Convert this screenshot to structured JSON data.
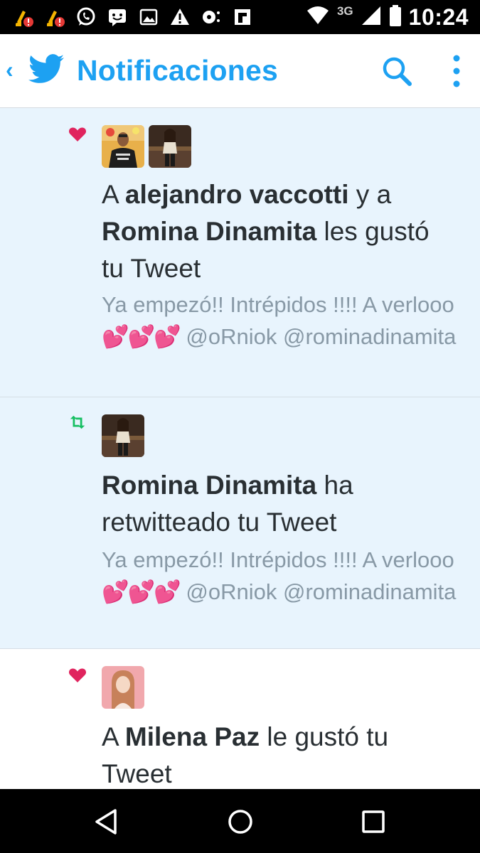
{
  "status_bar": {
    "time": "10:24",
    "network": "3G",
    "icons": [
      "cleaner-alert-icon",
      "cleaner-alert-icon",
      "whatsapp-icon",
      "messenger-icon",
      "gallery-icon",
      "warning-icon",
      "voicemail-icon",
      "flipboard-icon",
      "wifi-icon",
      "signal-icon",
      "battery-icon"
    ]
  },
  "app_bar": {
    "title": "Notificaciones",
    "back_icon": "chevron-left-icon",
    "logo_icon": "twitter-bird-icon",
    "actions": [
      "search-icon",
      "more-vertical-icon"
    ]
  },
  "notifications": [
    {
      "type": "like",
      "icon": "heart-icon",
      "unread": true,
      "avatars": [
        "avatar-alejandro",
        "avatar-romina"
      ],
      "headline": {
        "prefix": "A ",
        "user1": "alejandro vaccotti",
        "middle": " y a ",
        "user2": "Romina Dinamita",
        "suffix": " les gustó tu Tweet"
      },
      "tweet": {
        "text": "Ya empezó!! Intrépidos !!!! A verlooo",
        "emoji": "💕💕💕",
        "mentions": " @oRniok @rominadinamita"
      }
    },
    {
      "type": "retweet",
      "icon": "retweet-icon",
      "unread": true,
      "avatars": [
        "avatar-romina"
      ],
      "headline": {
        "user1": "Romina Dinamita",
        "suffix": " ha retwitteado tu Tweet"
      },
      "tweet": {
        "text": "Ya empezó!! Intrépidos !!!! A verlooo",
        "emoji": "💕💕💕",
        "mentions": " @oRniok @rominadinamita"
      }
    },
    {
      "type": "like",
      "icon": "heart-icon",
      "unread": false,
      "avatars": [
        "avatar-milena"
      ],
      "headline": {
        "prefix": "A ",
        "user1": "Milena Paz",
        "suffix": " le gustó tu Tweet"
      }
    }
  ],
  "nav_bar": {
    "buttons": [
      "back-triangle-icon",
      "home-circle-icon",
      "recents-square-icon"
    ]
  },
  "colors": {
    "accent": "#1da1f2",
    "heart": "#e0245e",
    "retweet": "#17bf63",
    "unread_bg": "#e8f4fd",
    "muted_text": "#8899a6"
  }
}
